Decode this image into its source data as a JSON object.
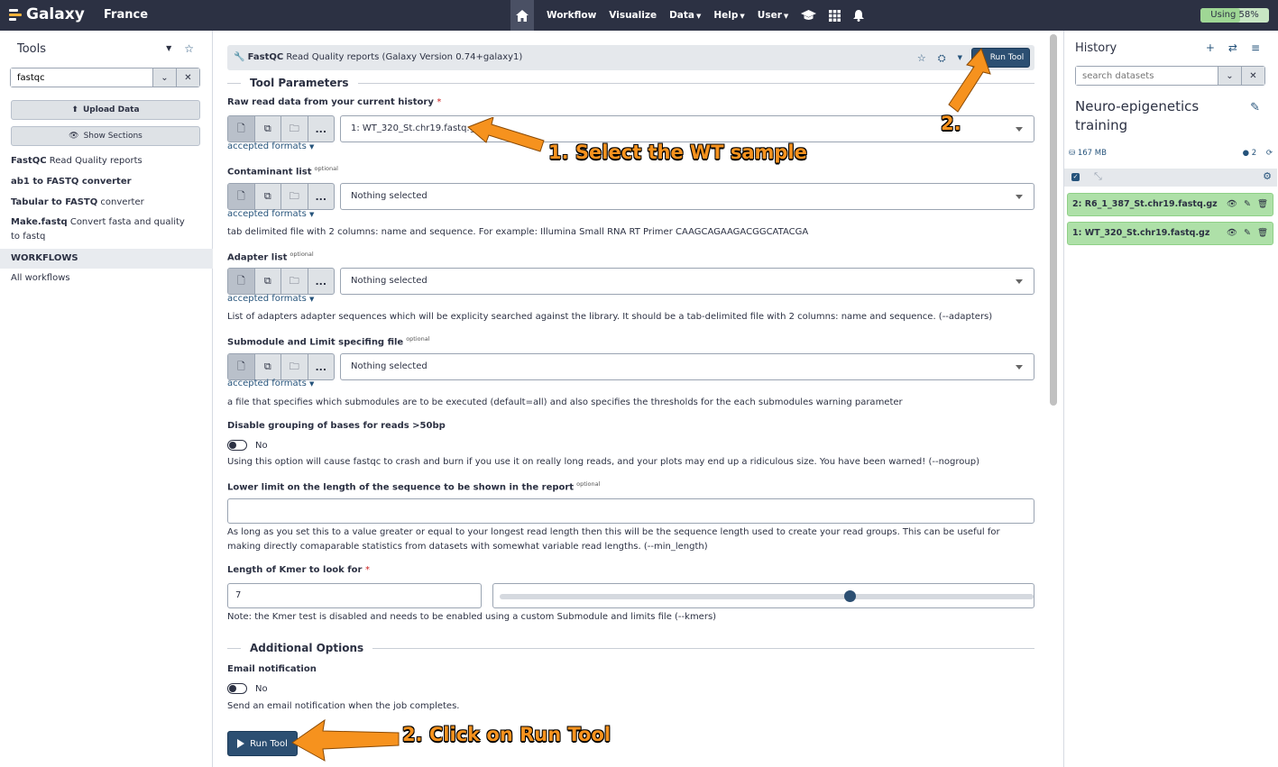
{
  "topbar": {
    "brand": "Galaxy",
    "instance": "France",
    "nav": [
      "Workflow",
      "Visualize",
      "Data",
      "Help",
      "User"
    ],
    "usage_label": "Using 58%",
    "usage_fraction": 0.58
  },
  "tools_panel": {
    "title": "Tools",
    "search_value": "fastqc",
    "upload_label": "Upload Data",
    "sections_label": "Show Sections",
    "results": [
      {
        "name": "FastQC",
        "desc": " Read Quality reports"
      },
      {
        "name": "ab1 to FASTQ converter",
        "desc": ""
      },
      {
        "name": "Tabular to FASTQ",
        "desc": " converter"
      },
      {
        "name": "Make.fastq",
        "desc": " Convert fasta and quality to fastq"
      }
    ],
    "workflows_heading": "WORKFLOWS",
    "all_workflows": "All workflows"
  },
  "tool_form": {
    "tool_name": "FastQC",
    "tool_desc": " Read Quality reports (Galaxy Version 0.74+galaxy1)",
    "run_label": "Run Tool",
    "section_params": "Tool Parameters",
    "raw_label": "Raw read data from your current history",
    "raw_value": "1: WT_320_St.chr19.fastq.gz",
    "accepted_formats": "accepted formats",
    "contaminant_label": "Contaminant list",
    "optional": "optional",
    "nothing_selected": "Nothing selected",
    "contaminant_help": "tab delimited file with 2 columns: name and sequence. For example: Illumina Small RNA RT Primer CAAGCAGAAGACGGCATACGA",
    "adapter_label": "Adapter list",
    "adapter_help": "List of adapters adapter sequences which will be explicity searched against the library. It should be a tab-delimited file with 2 columns: name and sequence. (--adapters)",
    "submodule_label": "Submodule and Limit specifing file",
    "submodule_help": "a file that specifies which submodules are to be executed (default=all) and also specifies the thresholds for the each submodules warning parameter",
    "nogroup_label": "Disable grouping of bases for reads >50bp",
    "no": "No",
    "nogroup_help": "Using this option will cause fastqc to crash and burn if you use it on really long reads, and your plots may end up a ridiculous size. You have been warned! (--nogroup)",
    "minlen_label": "Lower limit on the length of the sequence to be shown in the report",
    "minlen_help": "As long as you set this to a value greater or equal to your longest read length then this will be the sequence length used to create your read groups. This can be useful for making directly comaparable statistics from datasets with somewhat variable read lengths. (--min_length)",
    "kmer_label": "Length of Kmer to look for",
    "kmer_value": "7",
    "kmer_slider_fraction": 0.66,
    "kmer_help": "Note: the Kmer test is disabled and needs to be enabled using a custom Submodule and limits file (--kmers)",
    "section_additional": "Additional Options",
    "email_label": "Email notification",
    "email_help": "Send an email notification when the job completes."
  },
  "annotations": {
    "select_wt": "1. Select the WT sample",
    "step2_top": "2.",
    "click_run": "2. Click on Run Tool",
    "arrow_color": "#f6921e"
  },
  "history": {
    "title": "History",
    "search_placeholder": "search datasets",
    "name": "Neuro-epigenetics training",
    "size": "167 MB",
    "count": "2",
    "datasets": [
      {
        "label": "2: R6_1_387_St.chr19.fastq.gz"
      },
      {
        "label": "1: WT_320_St.chr19.fastq.gz"
      }
    ],
    "ok_color": "#aee0a8"
  }
}
